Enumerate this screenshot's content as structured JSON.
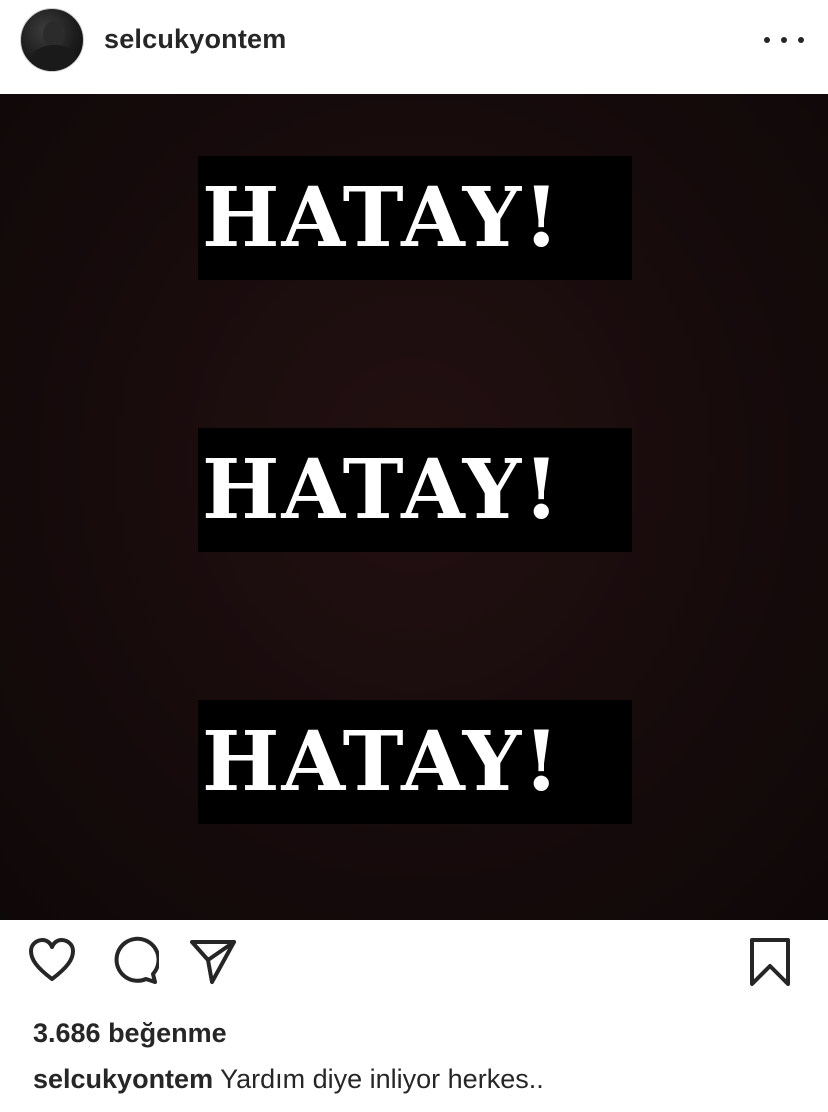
{
  "header": {
    "username": "selcukyontem",
    "more_icon": "more-horizontal-icon"
  },
  "post_image": {
    "background_color": "#170b0c",
    "banners": [
      {
        "text": "HATAY!"
      },
      {
        "text": "HATAY!"
      },
      {
        "text": "HATAY!"
      }
    ]
  },
  "actions": {
    "like_icon": "heart-icon",
    "comment_icon": "comment-icon",
    "share_icon": "send-icon",
    "save_icon": "bookmark-icon"
  },
  "likes": {
    "text": "3.686 beğenme"
  },
  "caption": {
    "username": "selcukyontem",
    "text": "Yardım diye inliyor herkes.."
  }
}
